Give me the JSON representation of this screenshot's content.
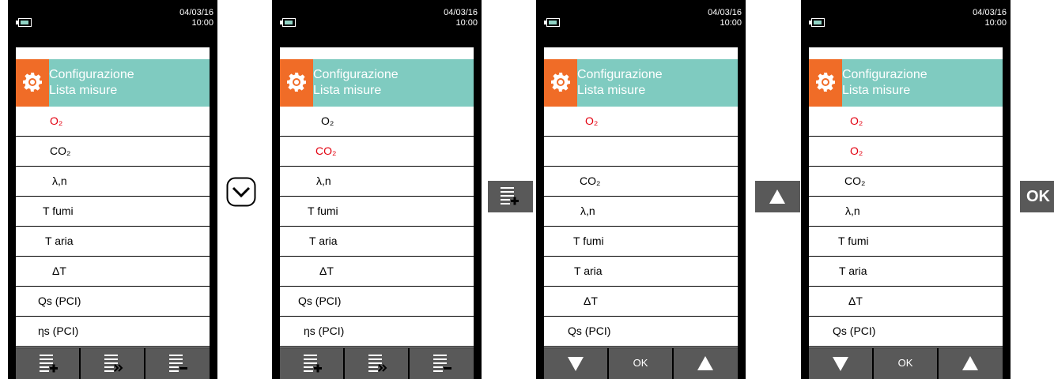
{
  "datetime": {
    "date": "04/03/16",
    "time": "10:00"
  },
  "header": {
    "line1": "Configurazione",
    "line2": "Lista misure"
  },
  "colors": {
    "accent_teal": "#7fcbc0",
    "icon_orange": "#f06c27",
    "selected_red": "#e3000f",
    "button_gray": "#595959"
  },
  "screens": [
    {
      "rows": [
        "O₂",
        "CO₂",
        "λ,n",
        "T fumi",
        "T aria",
        "ΔT",
        "Qs (PCI)",
        "ηs (PCI)"
      ],
      "selected": [
        0
      ],
      "footer": [
        "add-measure-icon",
        "move-measure-icon",
        "remove-measure-icon"
      ]
    },
    {
      "rows": [
        "O₂",
        "CO₂",
        "λ,n",
        "T fumi",
        "T aria",
        "ΔT",
        "Qs (PCI)",
        "ηs (PCI)"
      ],
      "selected": [
        1
      ],
      "footer": [
        "add-measure-icon",
        "move-measure-icon",
        "remove-measure-icon"
      ]
    },
    {
      "rows": [
        "O₂",
        "",
        "CO₂",
        "λ,n",
        "T fumi",
        "T aria",
        "ΔT",
        "Qs (PCI)"
      ],
      "selected": [
        0
      ],
      "footer": [
        "arrow-down-icon",
        "OK",
        "arrow-up-icon"
      ]
    },
    {
      "rows": [
        "O₂",
        "O₂",
        "CO₂",
        "λ,n",
        "T fumi",
        "T aria",
        "ΔT",
        "Qs (PCI)"
      ],
      "selected": [
        0,
        1
      ],
      "footer": [
        "arrow-down-icon",
        "OK",
        "arrow-up-icon"
      ]
    }
  ],
  "steps": [
    {
      "name": "step-down-button",
      "icon": "chevron-down-circle-icon"
    },
    {
      "name": "step-add-button",
      "icon": "add-measure-icon"
    },
    {
      "name": "step-up-button",
      "icon": "arrow-up-icon"
    },
    {
      "name": "step-ok-button",
      "label": "OK"
    }
  ]
}
